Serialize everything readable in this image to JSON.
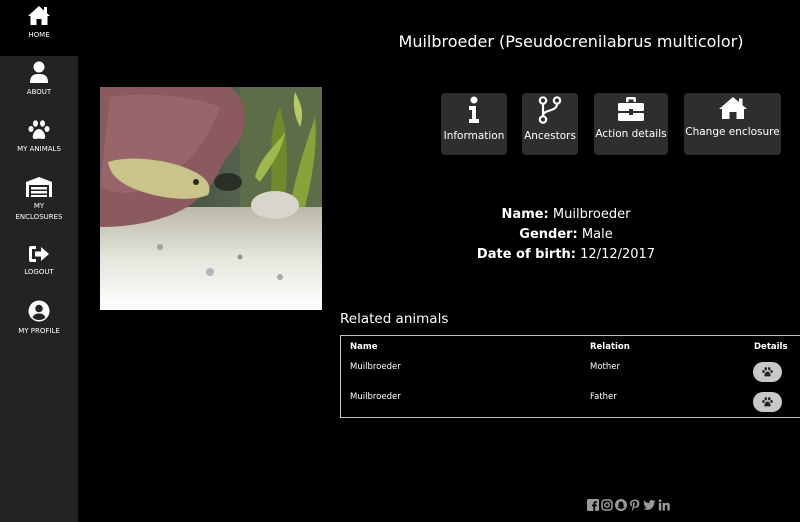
{
  "sidebar": {
    "items": [
      {
        "label": "HOME",
        "icon": "home-icon"
      },
      {
        "label": "ABOUT",
        "icon": "user-icon"
      },
      {
        "label": "MY ANIMALS",
        "icon": "paw-icon"
      },
      {
        "label": "MY\nENCLOSURES",
        "icon": "warehouse-icon"
      },
      {
        "label": "LOGOUT",
        "icon": "logout-icon"
      },
      {
        "label": "MY PROFILE",
        "icon": "user-circle-icon"
      }
    ]
  },
  "page": {
    "title": "Muilbroeder (Pseudocrenilabrus multicolor)"
  },
  "actions": [
    {
      "label": "Information",
      "icon": "info-icon"
    },
    {
      "label": "Ancestors",
      "icon": "git-branch-icon"
    },
    {
      "label": "Action details",
      "icon": "toolbox-icon"
    },
    {
      "label": "Change enclosure",
      "icon": "home-icon"
    }
  ],
  "info": {
    "name_label": "Name:",
    "name_value": "Muilbroeder",
    "gender_label": "Gender:",
    "gender_value": "Male",
    "dob_label": "Date of birth:",
    "dob_value": "12/12/2017"
  },
  "related": {
    "title": "Related animals",
    "headers": {
      "name": "Name",
      "relation": "Relation",
      "details": "Details"
    },
    "rows": [
      {
        "name": "Muilbroeder",
        "relation": "Mother"
      },
      {
        "name": "Muilbroeder",
        "relation": "Father"
      }
    ]
  },
  "social": [
    "facebook-icon",
    "instagram-icon",
    "snapchat-icon",
    "pinterest-icon",
    "twitter-icon",
    "linkedin-icon"
  ],
  "colors": {
    "background": "#000000",
    "sidebar": "#232323",
    "button": "#2e2e2e",
    "details_button": "#c8c8c8",
    "social": "#9a9a9a"
  }
}
